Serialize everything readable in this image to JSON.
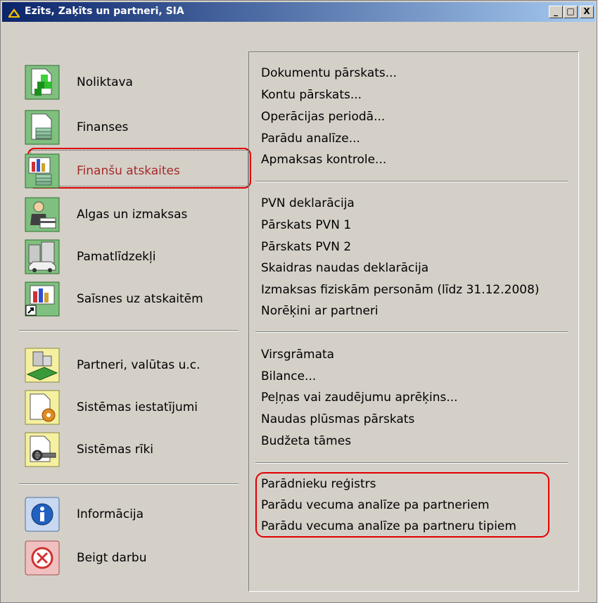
{
  "window": {
    "title": "Ezīts, Zaķīts un partneri, SIA",
    "buttons": {
      "minimize": "_",
      "maximize": "□",
      "close": "X"
    }
  },
  "nav": {
    "group1": [
      {
        "label": "Noliktava",
        "icon": "warehouse-icon"
      },
      {
        "label": "Finanses",
        "icon": "finance-icon"
      },
      {
        "label": "Finanšu atskaites",
        "icon": "finance-reports-icon",
        "selected": true
      },
      {
        "label": "Algas un izmaksas",
        "icon": "salary-icon"
      },
      {
        "label": "Pamatlīdzekļi",
        "icon": "fixed-assets-icon"
      },
      {
        "label": "Saīsnes uz atskaitēm",
        "icon": "report-shortcuts-icon"
      }
    ],
    "group2": [
      {
        "label": "Partneri, valūtas u.c.",
        "icon": "partners-icon"
      },
      {
        "label": "Sistēmas iestatījumi",
        "icon": "settings-icon"
      },
      {
        "label": "Sistēmas rīki",
        "icon": "tools-icon"
      }
    ],
    "group3": [
      {
        "label": "Informācija",
        "icon": "info-icon"
      },
      {
        "label": "Beigt darbu",
        "icon": "exit-icon"
      }
    ]
  },
  "menu": {
    "section1": [
      "Dokumentu pārskats...",
      "Kontu pārskats...",
      "Operācijas periodā...",
      "Parādu analīze...",
      "Apmaksas kontrole..."
    ],
    "section2": [
      "PVN deklarācija",
      "Pārskats PVN 1",
      "Pārskats PVN 2",
      "Skaidras naudas deklarācija",
      "Izmaksas fiziskām personām (līdz 31.12.2008)",
      "Norēķini ar partneri"
    ],
    "section3": [
      "Virsgrāmata",
      "Bilance...",
      "Peļņas vai zaudējumu aprēķins...",
      "Naudas plūsmas pārskats",
      "Budžeta tāmes"
    ],
    "section4": [
      "Parādnieku reģistrs",
      "Parādu vecuma analīze pa partneriem",
      "Parādu vecuma analīze pa partneru tipiem"
    ]
  },
  "colors": {
    "highlight_border": "#e00000",
    "selected_text": "#a52a2a",
    "titlebar_start": "#0a246a",
    "titlebar_end": "#a6caf0"
  }
}
